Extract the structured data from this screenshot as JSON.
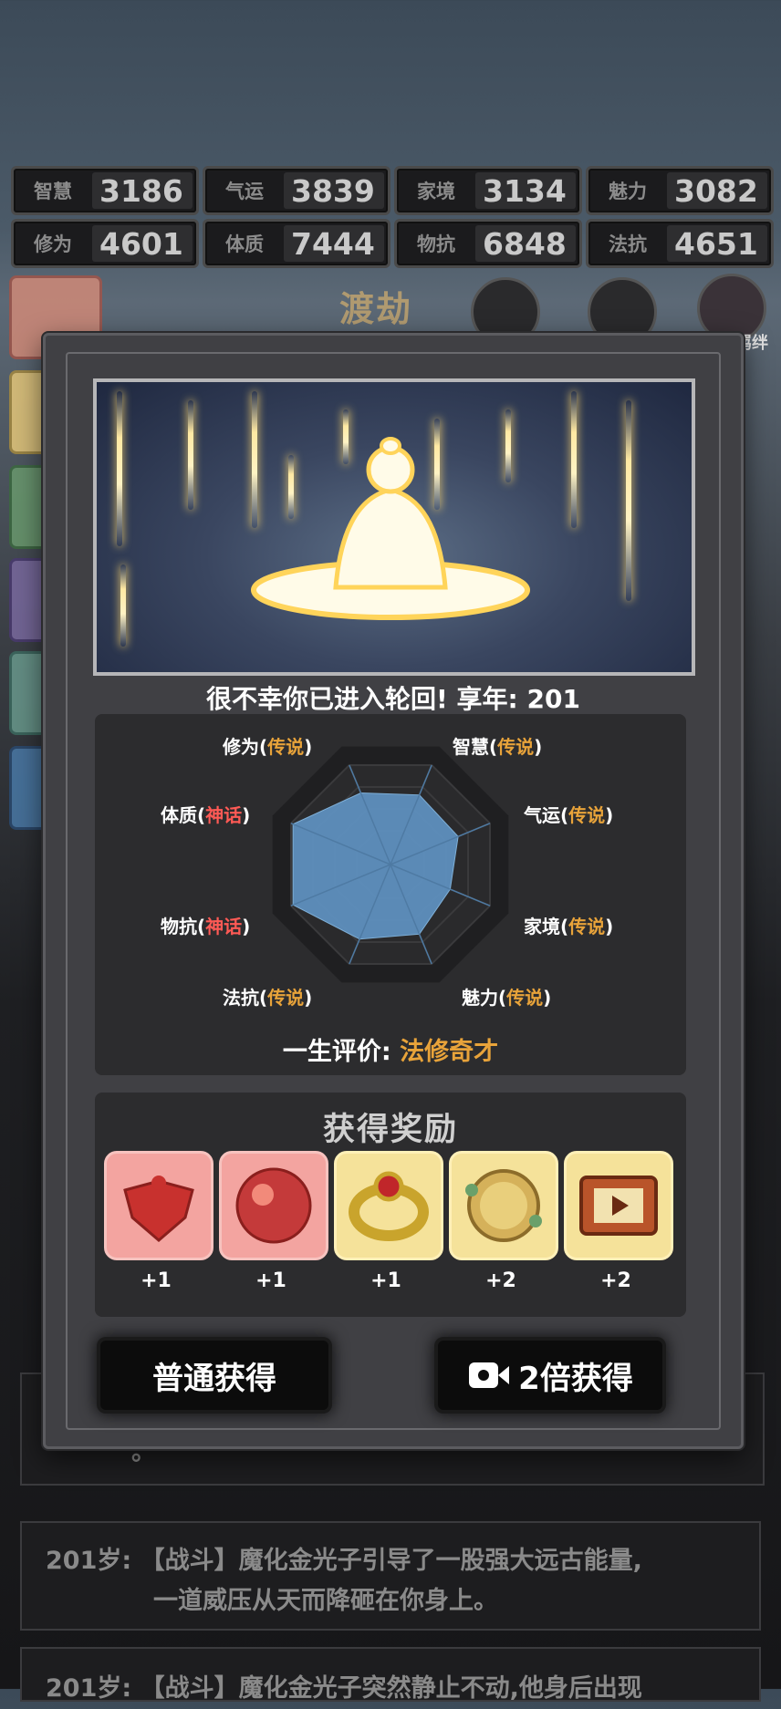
{
  "stats": [
    {
      "label": "智慧",
      "value": "3186"
    },
    {
      "label": "气运",
      "value": "3839"
    },
    {
      "label": "家境",
      "value": "3134"
    },
    {
      "label": "魅力",
      "value": "3082"
    },
    {
      "label": "修为",
      "value": "4601"
    },
    {
      "label": "体质",
      "value": "7444"
    },
    {
      "label": "物抗",
      "value": "6848"
    },
    {
      "label": "法抗",
      "value": "4651"
    }
  ],
  "background": {
    "title": "渡劫",
    "bond_label": "羁绊",
    "log_entries": [
      {
        "text": "。"
      },
      {
        "year": "201岁:",
        "text": "【战斗】魔化金光子引导了一股强大远古能量,",
        "cont": "一道威压从天而降砸在你身上。"
      },
      {
        "year": "201岁:",
        "text": "【战斗】魔化金光子突然静止不动,他身后出现"
      }
    ]
  },
  "modal": {
    "result_text": "很不幸你已进入轮回! 享年: 201",
    "radar": {
      "labels": [
        {
          "name": "修为",
          "grade": "传说",
          "type": "legend"
        },
        {
          "name": "智慧",
          "grade": "传说",
          "type": "legend"
        },
        {
          "name": "气运",
          "grade": "传说",
          "type": "legend"
        },
        {
          "name": "家境",
          "grade": "传说",
          "type": "legend"
        },
        {
          "name": "魅力",
          "grade": "传说",
          "type": "legend"
        },
        {
          "name": "法抗",
          "grade": "传说",
          "type": "legend"
        },
        {
          "name": "物抗",
          "grade": "神话",
          "type": "myth"
        },
        {
          "name": "体质",
          "grade": "神话",
          "type": "myth"
        }
      ],
      "values": [
        0.72,
        0.7,
        0.68,
        0.6,
        0.7,
        0.75,
        0.98,
        0.98
      ],
      "fill_color": "#5f93c2",
      "rim_color": "#1f1f21",
      "ring_color": "#3a3a3c"
    },
    "evaluation_label": "一生评价:",
    "evaluation_value": "法修奇才",
    "rewards_title": "获得奖励",
    "rewards": [
      {
        "icon": "heart-puzzle-icon",
        "qty": "+1",
        "bg": "pink"
      },
      {
        "icon": "red-orb-icon",
        "qty": "+1",
        "bg": "pink"
      },
      {
        "icon": "gold-ring-icon",
        "qty": "+1",
        "bg": "gold"
      },
      {
        "icon": "jade-amulet-icon",
        "qty": "+2",
        "bg": "gold"
      },
      {
        "icon": "video-scroll-icon",
        "qty": "+2",
        "bg": "gold"
      }
    ],
    "normal_button": "普通获得",
    "double_button": "2倍获得"
  },
  "colors": {
    "legend": "#e8a33a",
    "myth": "#ff5a55"
  }
}
